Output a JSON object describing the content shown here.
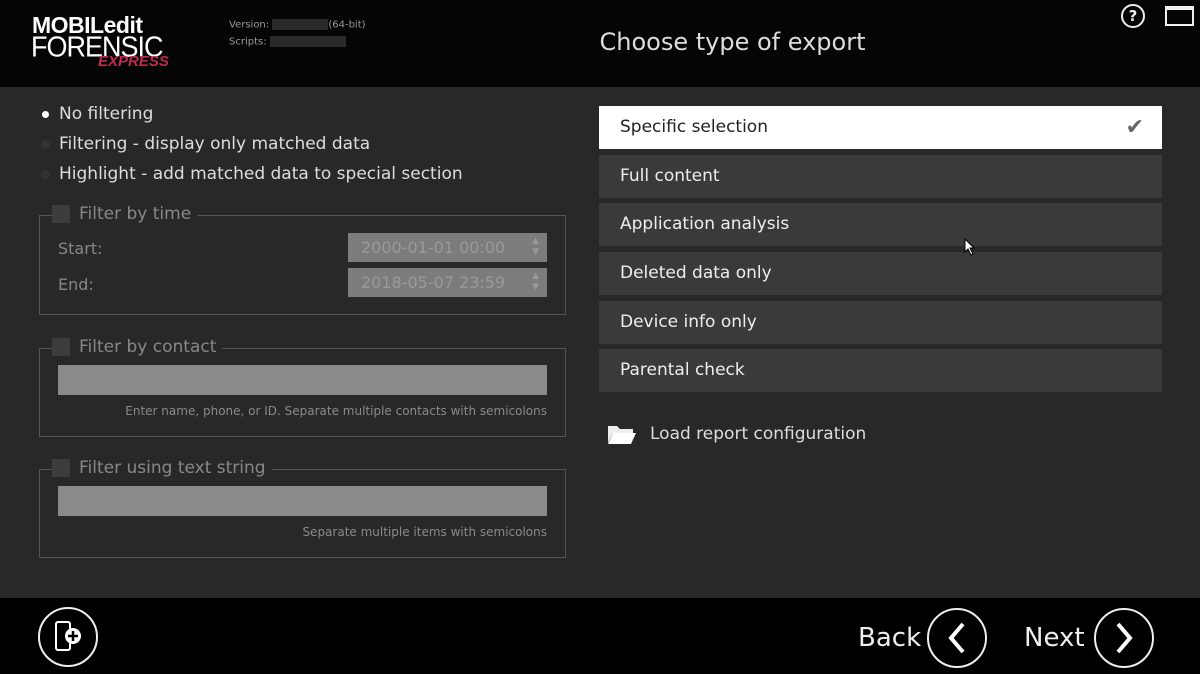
{
  "header": {
    "logo_line1": "MOBILedit",
    "logo_line2": "FORENSIC",
    "logo_line3": "EXPRESS",
    "version_label": "Version:",
    "version_suffix": "(64-bit)",
    "scripts_label": "Scripts:",
    "title": "Choose type of export"
  },
  "filters": {
    "mode_options": [
      {
        "label": "No filtering",
        "selected": true
      },
      {
        "label": "Filtering - display only matched data",
        "selected": false
      },
      {
        "label": "Highlight - add matched data to special section",
        "selected": false
      }
    ],
    "time": {
      "label": "Filter by time",
      "checked": false,
      "start_label": "Start:",
      "start_value": "2000-01-01 00:00",
      "end_label": "End:",
      "end_value": "2018-05-07 23:59"
    },
    "contact": {
      "label": "Filter by contact",
      "checked": false,
      "value": "",
      "hint": "Enter name, phone, or ID. Separate multiple contacts with semicolons"
    },
    "text": {
      "label": "Filter using text string",
      "checked": false,
      "value": "",
      "hint": "Separate multiple items with semicolons"
    }
  },
  "export_types": [
    {
      "label": "Specific selection",
      "selected": true
    },
    {
      "label": "Full content"
    },
    {
      "label": "Application analysis"
    },
    {
      "label": "Deleted data only"
    },
    {
      "label": "Device info only"
    },
    {
      "label": "Parental check"
    }
  ],
  "load_config": "Load report configuration",
  "footer": {
    "back": "Back",
    "next": "Next"
  }
}
